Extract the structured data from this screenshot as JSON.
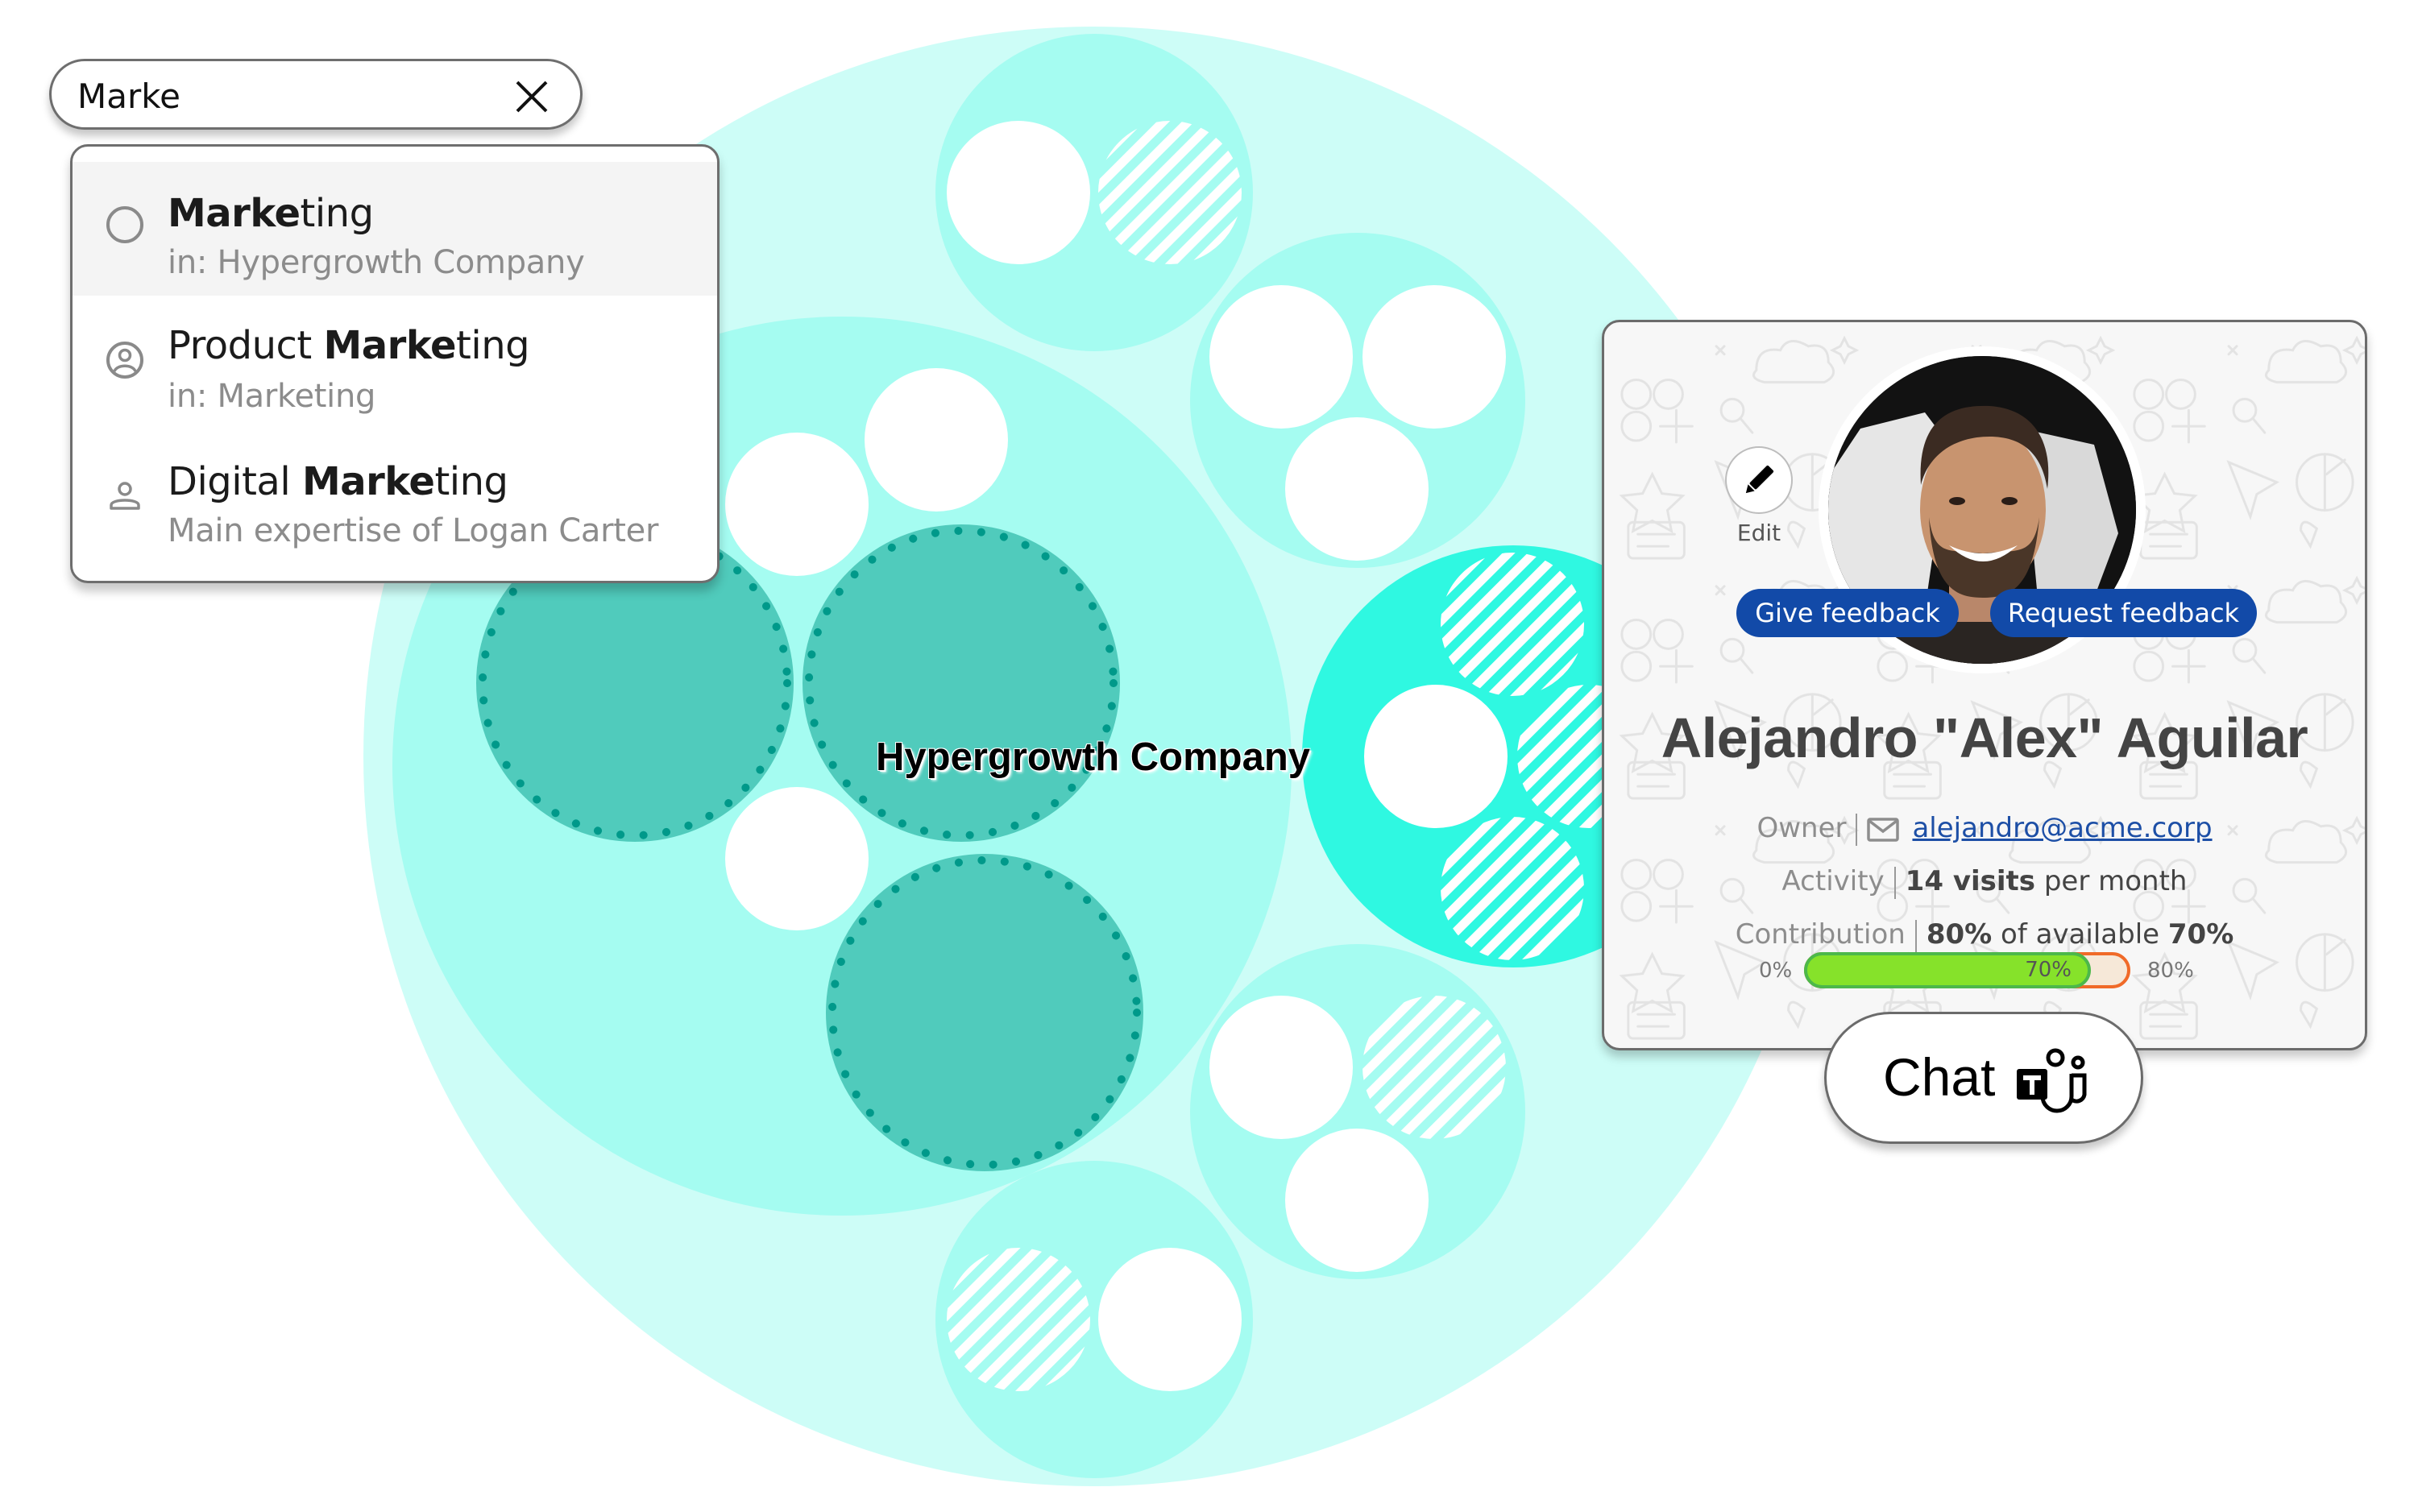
{
  "search": {
    "value": "Marke",
    "clear_icon": "close-icon",
    "results": [
      {
        "icon": "circle-outline-icon",
        "title_bold": "Marke",
        "title_rest": "ting",
        "title_prefix": "",
        "subtitle": "in: Hypergrowth Company",
        "active": true
      },
      {
        "icon": "user-circle-icon",
        "title_prefix": "Product ",
        "title_bold": "Marke",
        "title_rest": "ting",
        "subtitle": "in: Marketing",
        "active": false
      },
      {
        "icon": "person-icon",
        "title_prefix": "Digital ",
        "title_bold": "Marke",
        "title_rest": "ting",
        "subtitle": "Main expertise of Logan Carter",
        "active": false
      }
    ]
  },
  "chart": {
    "root_label": "Hypergrowth Company",
    "colors": {
      "root": "#cdfdf7",
      "group": "#a5fcf1",
      "selected_group": "#2ff8e1",
      "matched_team": "#50cbbc",
      "matched_team_dots": "#00998a",
      "member": "#ffffff"
    },
    "groups": [
      {
        "name": "marketing-group",
        "kind": "group",
        "children": [
          "matched-team",
          "matched-team",
          "matched-team",
          "member",
          "member",
          "member"
        ]
      },
      {
        "name": "top-group",
        "kind": "group",
        "children": [
          "member",
          "striped-member"
        ]
      },
      {
        "name": "upper-right-group",
        "kind": "group",
        "children": [
          "member",
          "member",
          "member"
        ]
      },
      {
        "name": "highlighted-group",
        "kind": "selected_group",
        "children": [
          "member",
          "striped-member",
          "striped-member",
          "striped-member"
        ]
      },
      {
        "name": "lower-right-group",
        "kind": "group",
        "children": [
          "member",
          "striped-member",
          "member"
        ]
      },
      {
        "name": "bottom-group",
        "kind": "group",
        "children": [
          "striped-member",
          "member"
        ]
      }
    ]
  },
  "profile": {
    "edit_label": "Edit",
    "give_feedback": "Give feedback",
    "request_feedback": "Request feedback",
    "name": "Alejandro \"Alex\" Aguilar",
    "owner_label": "Owner",
    "email": "alejandro@acme.corp",
    "activity_label": "Activity",
    "activity_value": "14 visits",
    "activity_suffix": " per month",
    "contribution_label": "Contribution",
    "contribution_value": "80%",
    "contribution_mid": " of available ",
    "contribution_available": "70%",
    "progress": {
      "min_label": "0%",
      "max_label": "80%",
      "fill_label": "70%",
      "fill_value": 70,
      "max_value": 80,
      "fill_color": "#86e22a",
      "fill_border": "#4cb84a",
      "over_border": "#f06a28",
      "over_bg": "#f6e8d8"
    },
    "accent": "#124aa8",
    "link_color": "#1d4fa6"
  },
  "chat": {
    "label": "Chat",
    "icon": "teams-icon"
  }
}
